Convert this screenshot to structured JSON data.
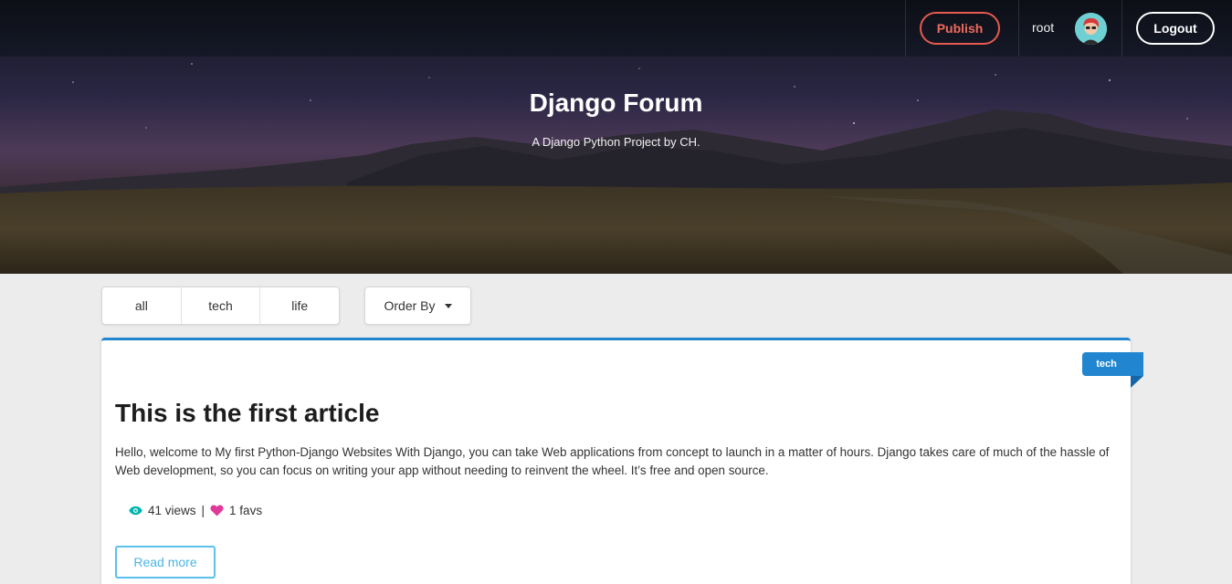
{
  "nav": {
    "publish_label": "Publish",
    "username": "root",
    "logout_label": "Logout"
  },
  "hero": {
    "title": "Django Forum",
    "subtitle": "A Django Python Project by CH."
  },
  "filters": {
    "tabs": [
      {
        "label": "all"
      },
      {
        "label": "tech"
      },
      {
        "label": "life"
      }
    ],
    "order_label": "Order By"
  },
  "article": {
    "category": "tech",
    "title": "This is the first article",
    "body": "Hello, welcome to My first Python-Django Websites With Django, you can take Web applications from concept to launch in a matter of hours. Django takes care of much of the hassle of Web development, so you can focus on writing your app without needing to reinvent the wheel. It’s free and open source.",
    "views": "41 views",
    "favs": "1 favs",
    "read_more_label": "Read more"
  },
  "colors": {
    "accent_blue": "#2185d0",
    "publish_red": "#e55a4f",
    "view_icon": "#00b5ad",
    "fav_icon": "#e03997",
    "read_more": "#5bc0eb"
  }
}
